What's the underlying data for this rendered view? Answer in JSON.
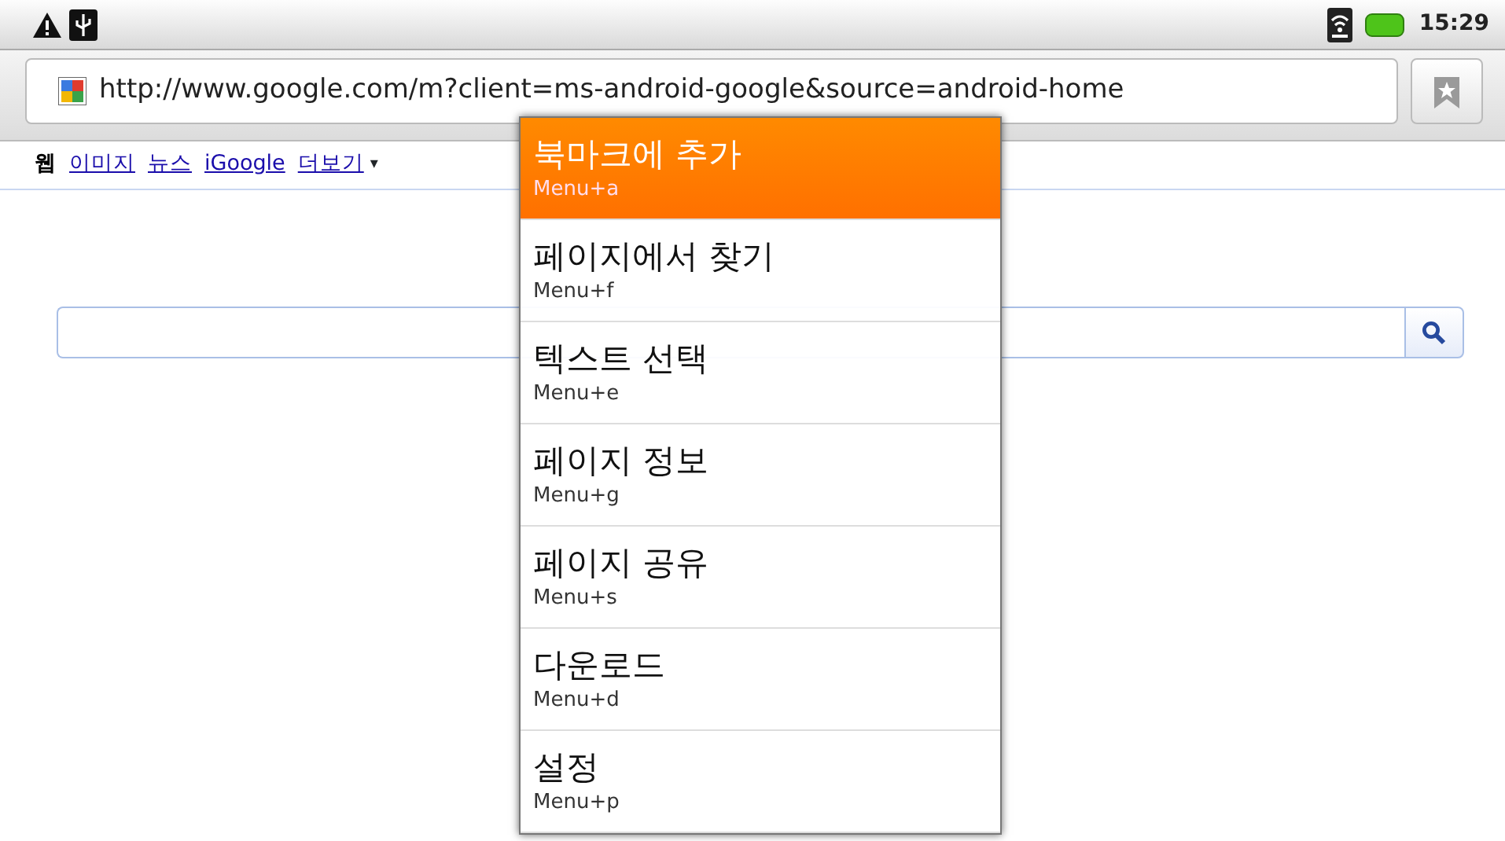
{
  "status_bar": {
    "time": "15:29"
  },
  "address_bar": {
    "url": "http://www.google.com/m?client=ms-android-google&source=android-home"
  },
  "nav_links": [
    {
      "label": "웹",
      "selected": true
    },
    {
      "label": "이미지",
      "selected": false
    },
    {
      "label": "뉴스",
      "selected": false
    },
    {
      "label": "iGoogle",
      "selected": false
    },
    {
      "label": "더보기",
      "selected": false,
      "caret": "▾"
    }
  ],
  "menu": [
    {
      "label": "북마크에 추가",
      "shortcut": "Menu+a",
      "selected": true
    },
    {
      "label": "페이지에서 찾기",
      "shortcut": "Menu+f",
      "selected": false
    },
    {
      "label": "텍스트 선택",
      "shortcut": "Menu+e",
      "selected": false
    },
    {
      "label": "페이지 정보",
      "shortcut": "Menu+g",
      "selected": false
    },
    {
      "label": "페이지 공유",
      "shortcut": "Menu+s",
      "selected": false
    },
    {
      "label": "다운로드",
      "shortcut": "Menu+d",
      "selected": false
    },
    {
      "label": "설정",
      "shortcut": "Menu+p",
      "selected": false
    }
  ]
}
